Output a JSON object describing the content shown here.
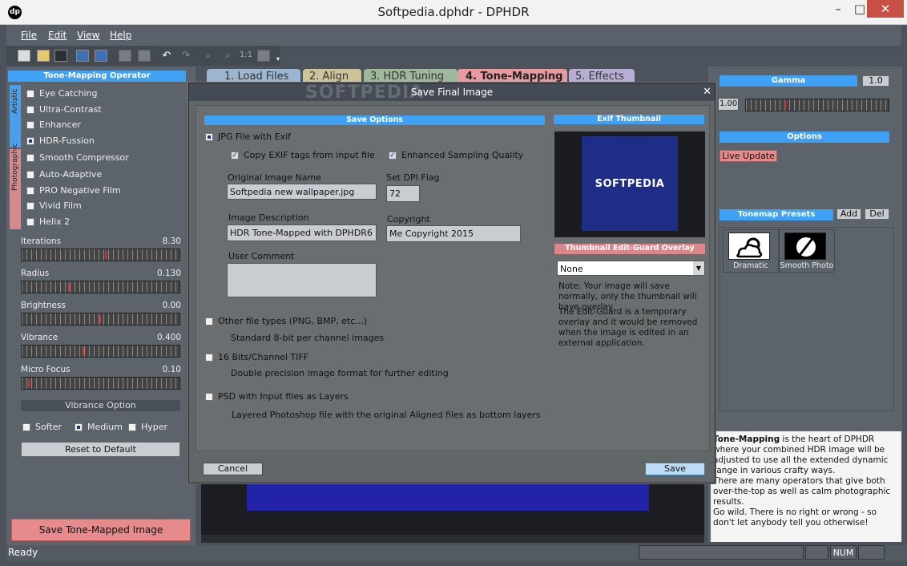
{
  "window": {
    "title": "Softpedia.dphdr - DPHDR",
    "logo_text": "dp",
    "minimize": "–",
    "maximize": "□",
    "close": "✕"
  },
  "menu": [
    "File",
    "Edit",
    "View",
    "Help"
  ],
  "toolbar": {
    "zoom_label": "1:1",
    "icons": [
      "new-icon",
      "open-icon",
      "save-icon",
      "save-as-icon",
      "export-icon",
      "copy-icon",
      "paste-icon",
      "undo-icon",
      "redo-icon",
      "zoom-in-icon",
      "zoom-out-icon",
      "actual-size-icon",
      "fit-icon"
    ]
  },
  "left_panel": {
    "header": "Tone-Mapping Operator",
    "group_artistic": "Artistic",
    "group_photographic": "Photographic",
    "operators": [
      {
        "label": "Eye Catching",
        "selected": false
      },
      {
        "label": "Ultra-Contrast",
        "selected": false
      },
      {
        "label": "Enhancer",
        "selected": false
      },
      {
        "label": "HDR-Fussion",
        "selected": true
      },
      {
        "label": "Smooth Compressor",
        "selected": false
      },
      {
        "label": "Auto-Adaptive",
        "selected": false
      },
      {
        "label": "PRO Negative Film",
        "selected": false
      },
      {
        "label": "Vivid Film",
        "selected": false
      },
      {
        "label": "Helix 2",
        "selected": false
      }
    ],
    "sliders": [
      {
        "label": "Iterations",
        "value": "8.30"
      },
      {
        "label": "Radius",
        "value": "0.130"
      },
      {
        "label": "Brightness",
        "value": "0.00"
      },
      {
        "label": "Vibrance",
        "value": "0.400"
      },
      {
        "label": "Micro Focus",
        "value": "0.10"
      }
    ],
    "vibrance_option_label": "Vibrance Option",
    "vibrance_options": [
      {
        "label": "Softer",
        "selected": false
      },
      {
        "label": "Medium",
        "selected": true
      },
      {
        "label": "Hyper",
        "selected": false
      }
    ],
    "reset_label": "Reset to Default",
    "save_label": "Save Tone-Mapped Image"
  },
  "tabs": [
    {
      "label": "1. Load Files",
      "color": "#9db6cf"
    },
    {
      "label": "2. Align",
      "color": "#cdc39a"
    },
    {
      "label": "3. HDR Tuning",
      "color": "#9fb79a"
    },
    {
      "label": "4. Tone-Mapping",
      "color": "#e79aa0",
      "active": true
    },
    {
      "label": "5. Effects",
      "color": "#b8aed4"
    }
  ],
  "watermark": "SOFTPEDIA",
  "right_panel": {
    "gamma_header": "Gamma",
    "gamma_value": "1.0",
    "gamma_input": "1.00",
    "options_header": "Options",
    "live_update_label": "Live Update",
    "presets_header": "Tonemap Presets",
    "add_label": "Add",
    "del_label": "Del",
    "presets": [
      {
        "name": "Dramatic",
        "icon": "cloud-sun-icon"
      },
      {
        "name": "Smooth Photo",
        "icon": "slashed-circle-icon"
      }
    ]
  },
  "info": {
    "bold": "Tone-Mapping",
    "p1": " is the heart of DPHDR where your combined HDR image will be adjusted to use all the extended dynamic range in various crafty ways.",
    "p2": "There are many operators that give both over-the-top as well as calm photographic results.",
    "p3": "Go wild. There is no right or wrong - so don't let anybody tell you otherwise!"
  },
  "viewer_caption": "",
  "status": {
    "ready": "Ready",
    "num": "NUM"
  },
  "dialog": {
    "title": "Save Final Image",
    "close": "✕",
    "save_options_header": "Save Options",
    "exif_thumbnail_header": "Exif Thumbnail",
    "jpg_option": "JPG File with Exif",
    "copy_exif_label": "Copy EXIF tags from input file",
    "enhanced_sampling_label": "Enhanced Sampling Quality",
    "original_name_label": "Original Image Name",
    "original_name_value": "Softpedia new wallpaper.jpg",
    "dpi_label": "Set DPI Flag",
    "dpi_value": "72",
    "description_label": "Image Description",
    "description_value": "HDR Tone-Mapped with DPHDR6",
    "copyright_label": "Copyright",
    "copyright_value": "Me Copyright 2015",
    "user_comment_label": "User Comment",
    "user_comment_value": "",
    "other_types_label": "Other file types (PNG, BMP, etc...)",
    "other_types_desc": "Standard 8-bit per channel images",
    "tiff_label": "16 Bits/Channel TIFF",
    "tiff_desc": "Double precision image format for further editing",
    "psd_label": "PSD with Input files as Layers",
    "psd_desc": "Layered Photoshop file with the original Aligned files as bottom layers",
    "thumbnail_text": "SOFTPEDIA",
    "overlay_header": "Thumbnail Edit-Guard Overlay",
    "overlay_value": "None",
    "note1": "Note: Your image will save normally, only the thumbnail will have overlay.",
    "note2": "The Edit-Guard is a temporary overlay and it would be removed when the image is edited in an external application.",
    "cancel_label": "Cancel",
    "save_label": "Save"
  }
}
